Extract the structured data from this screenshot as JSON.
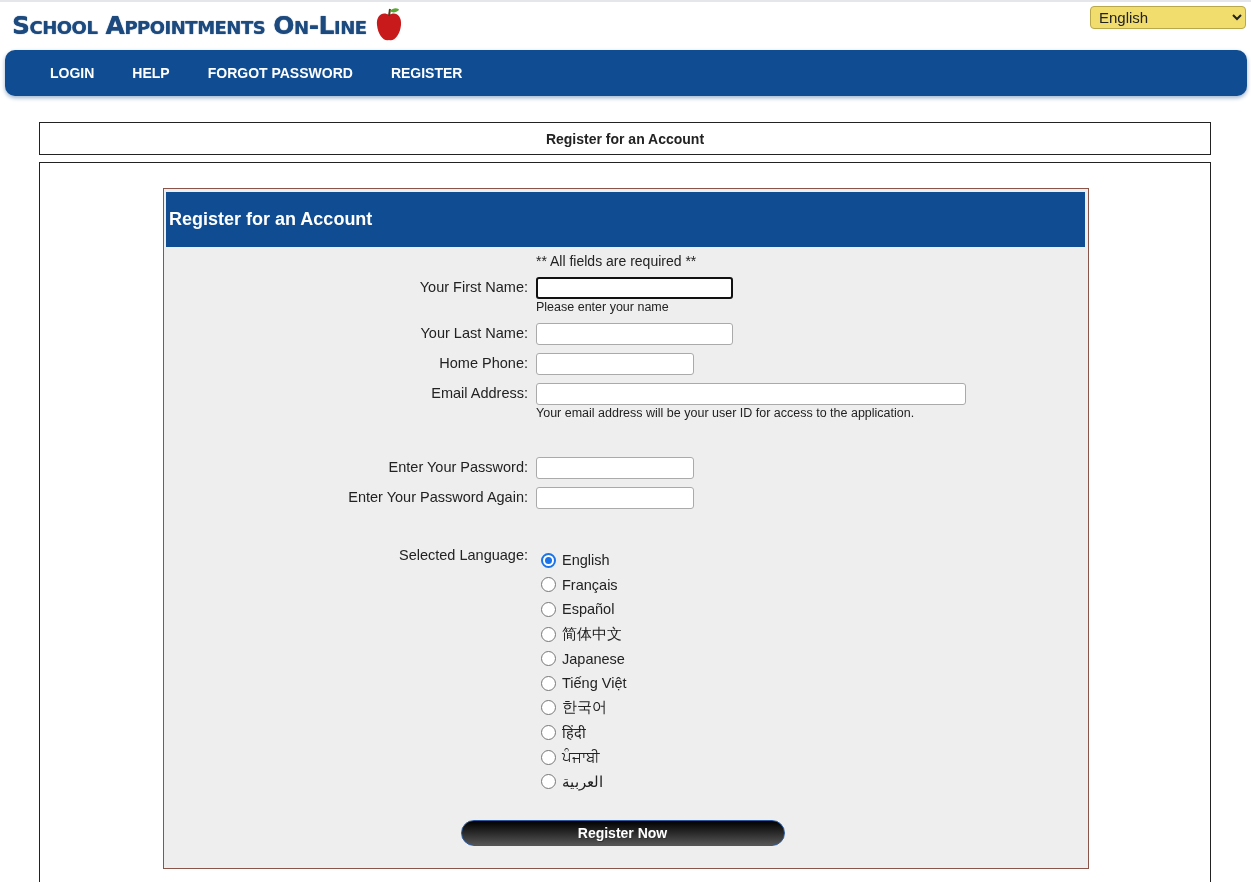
{
  "logo": {
    "title": "School Appointments On-Line"
  },
  "language_select": {
    "value": "English"
  },
  "nav": [
    {
      "label": "LOGIN"
    },
    {
      "label": "HELP"
    },
    {
      "label": "FORGOT PASSWORD"
    },
    {
      "label": "REGISTER"
    }
  ],
  "page_title": "Register for an Account",
  "form": {
    "title": "Register for an Account",
    "note": "** All fields are required **",
    "sections": [
      {
        "fields": [
          {
            "label": "Your First Name:",
            "kind": "name",
            "focused": true,
            "hint": "Please enter your name"
          },
          {
            "label": "Your Last Name:",
            "kind": "name",
            "focused": false
          },
          {
            "label": "Home Phone:",
            "kind": "phone",
            "focused": false
          },
          {
            "label": "Email Address:",
            "kind": "email",
            "focused": false,
            "hint": "Your email address will be your user ID for access to the application."
          }
        ]
      },
      {
        "fields": [
          {
            "label": "Enter Your Password:",
            "kind": "password",
            "focused": false
          },
          {
            "label": "Enter Your Password Again:",
            "kind": "password",
            "focused": false
          }
        ]
      }
    ],
    "language_label": "Selected Language:",
    "languages": [
      {
        "label": "English",
        "selected": true
      },
      {
        "label": "Français",
        "selected": false
      },
      {
        "label": "Español",
        "selected": false
      },
      {
        "label": "简体中文",
        "selected": false
      },
      {
        "label": "Japanese",
        "selected": false
      },
      {
        "label": "Tiếng Việt",
        "selected": false
      },
      {
        "label": "한국어",
        "selected": false
      },
      {
        "label": "हिंदी",
        "selected": false
      },
      {
        "label": "ਪੰਜਾਬੀ",
        "selected": false
      },
      {
        "label": "العربية",
        "selected": false
      }
    ],
    "submit": "Register Now"
  }
}
